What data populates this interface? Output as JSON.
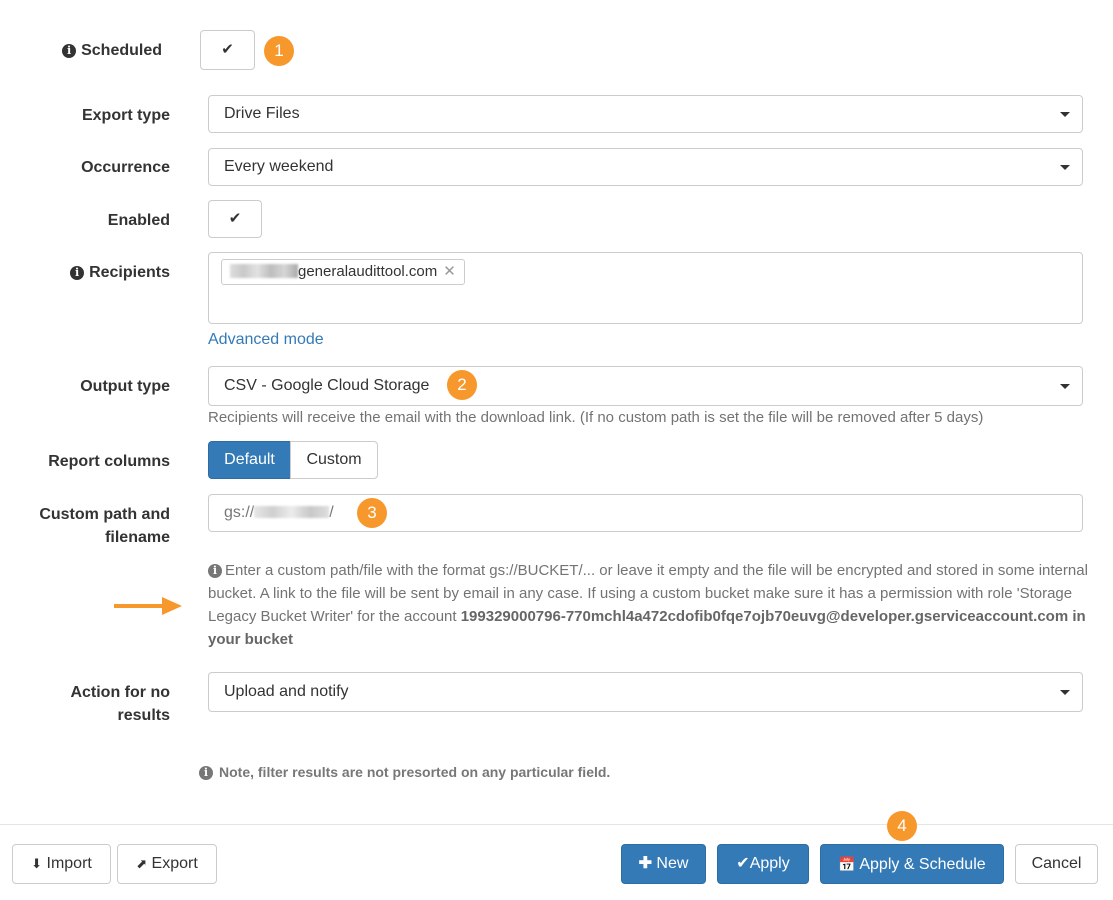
{
  "form": {
    "scheduled": {
      "label": "Scheduled",
      "checked": true,
      "badge": "1"
    },
    "export_type": {
      "label": "Export type",
      "value": "Drive Files"
    },
    "occurrence": {
      "label": "Occurrence",
      "value": "Every weekend"
    },
    "enabled": {
      "label": "Enabled",
      "checked": true
    },
    "recipients": {
      "label": "Recipients",
      "tag_domain": "generalaudittool.com",
      "advanced_link": "Advanced mode"
    },
    "output_type": {
      "label": "Output type",
      "value": "CSV - Google Cloud Storage",
      "badge": "2",
      "help": "Recipients will receive the email with the download link. (If no custom path is set the file will be removed after 5 days)"
    },
    "report_columns": {
      "label": "Report columns",
      "options": [
        "Default",
        "Custom"
      ],
      "selected": "Default"
    },
    "custom_path": {
      "label_line1": "Custom path and",
      "label_line2": "filename",
      "value_prefix": "gs://",
      "value_suffix": "/",
      "badge": "3",
      "help_text": "Enter a custom path/file with the format gs://BUCKET/... or leave it empty and the file will be encrypted and stored in some internal bucket. A link to the file will be sent by email in any case. If using a custom bucket make sure it has a permission with role 'Storage Legacy Bucket Writer' for the account ",
      "help_account": "199329000796-770mchl4a472cdofib0fqe7ojb70euvg@developer.gserviceaccount.com in your bucket"
    },
    "action_no_results": {
      "label_line1": "Action for no",
      "label_line2": "results",
      "value": "Upload and notify"
    },
    "note": "Note, filter results are not presorted on any particular field."
  },
  "footer": {
    "import": "Import",
    "export": "Export",
    "new": "New",
    "apply": "Apply",
    "apply_schedule": "Apply & Schedule",
    "apply_schedule_badge": "4",
    "cancel": "Cancel"
  },
  "colors": {
    "accent": "#f7982d",
    "primary": "#337ab7",
    "label": "#333333",
    "help": "#737373"
  }
}
